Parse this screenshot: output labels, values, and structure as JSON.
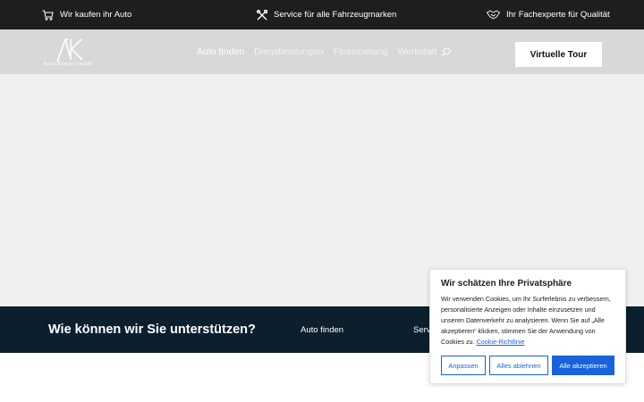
{
  "topbar": {
    "items": [
      {
        "label": "Wir kaufen ihr Auto",
        "icon": "cart-icon"
      },
      {
        "label": "Service für alle Fahrzeugmarken",
        "icon": "tools-icon"
      },
      {
        "label": "Ihr Fachexperte für Qualität",
        "icon": "handshake-icon"
      }
    ]
  },
  "header": {
    "logo_text": "Auto König GmbH",
    "nav": [
      {
        "label": "Auto finden"
      },
      {
        "label": "Dienstleistungen"
      },
      {
        "label": "Finanzierung"
      },
      {
        "label": "Werkstatt"
      }
    ],
    "cta_label": "Virtuelle Tour"
  },
  "band": {
    "title": "Wie können wir Sie unterstützen?",
    "links": [
      "Auto finden",
      "Serv"
    ]
  },
  "cookie": {
    "title": "Wir schätzen Ihre Privatsphäre",
    "text": "Wir verwenden Cookies, um Ihr Surferlebnis zu verbessern, personalisierte Anzeigen oder Inhalte einzusetzen und unseren Datenverkehr zu analysieren. Wenn Sie auf „Alle akzeptieren“ klicken, stimmen Sie der Anwendung von Cookies zu. ",
    "link_label": "Cookie-Richtlinie",
    "buttons": {
      "customize": "Anpassen",
      "reject": "Alles ablehnen",
      "accept": "Alle akzeptieren"
    }
  },
  "colors": {
    "topbar_bg": "#1e1e1e",
    "header_bg": "#d8d8d8",
    "band_bg": "#0b1f2d",
    "accent": "#1863dc"
  }
}
